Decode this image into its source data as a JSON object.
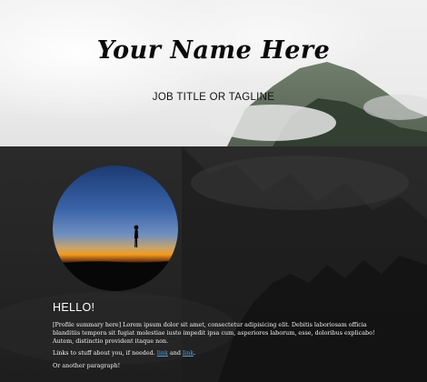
{
  "header": {
    "name": "Your Name Here",
    "tagline": "JOB TITLE OR TAGLINE"
  },
  "about": {
    "heading": "HELLO!",
    "summary": "[Profile summary here] Lorem ipsum dolor sit amet, consectetur adipisicing elit. Debitis laboriosam officia blanditiis tempora sit fugiat molestiae iusto impedit ipsa cum, asperiores laborum, esse, doloribus explicabo! Autem, distinctio provident itaque non.",
    "links_prefix": "Links to stuff about you, if needed. ",
    "link1": "link",
    "links_and": " and ",
    "link2": "link",
    "links_suffix": ".",
    "another": "Or another paragraph!"
  },
  "colors": {
    "link": "#4fa3e0",
    "dark_background": "#222222"
  }
}
